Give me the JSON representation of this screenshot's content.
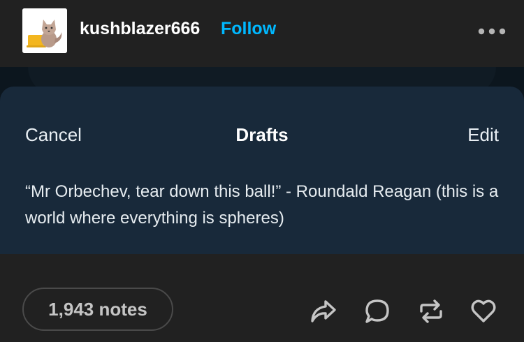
{
  "header": {
    "username": "kushblazer666",
    "follow_label": "Follow",
    "more_icon": "more-dots-icon",
    "avatar_icon": "fox-avatar-icon"
  },
  "post": {
    "drafts_sheet": {
      "cancel_label": "Cancel",
      "title": "Drafts",
      "edit_label": "Edit",
      "draft_text": "“Mr Orbechev, tear down this ball!” - Roundald Reagan (this is a world where everything is spheres)"
    }
  },
  "footer": {
    "notes_label": "1,943 notes",
    "actions": [
      {
        "icon": "share-icon"
      },
      {
        "icon": "comment-icon"
      },
      {
        "icon": "reblog-icon"
      },
      {
        "icon": "heart-icon"
      }
    ]
  },
  "colors": {
    "accent": "#00b8ff",
    "background": "#212121",
    "card": "#18293a"
  }
}
